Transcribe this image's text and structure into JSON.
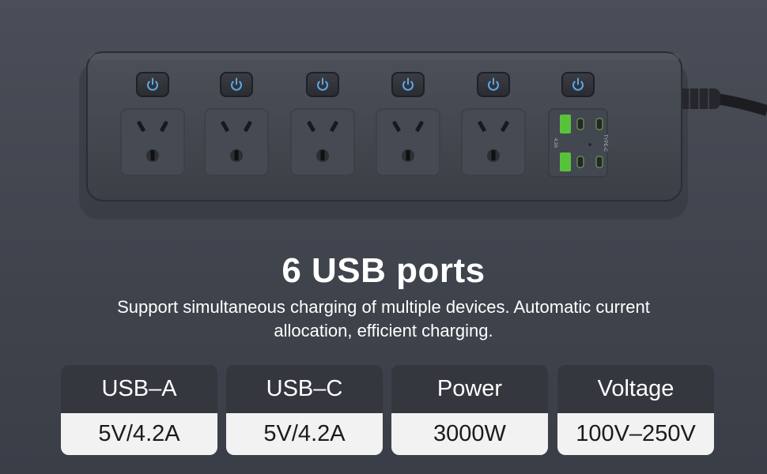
{
  "product": {
    "usb_a_rating": "4.2A",
    "type_c_label": "TYPE-C",
    "outlet_count": 5,
    "switch_count": 6,
    "switch_icon": "power-icon",
    "switch_light_color": "#5aa8e6",
    "usb_a_color": "#58c33a"
  },
  "headline": "6 USB ports",
  "subtitle": {
    "line1": "Support simultaneous charging of multiple devices. Automatic current",
    "line2": "allocation, efficient charging."
  },
  "specs": [
    {
      "label": "USB–A",
      "value": "5V/4.2A"
    },
    {
      "label": "USB–C",
      "value": "5V/4.2A"
    },
    {
      "label": "Power",
      "value": "3000W"
    },
    {
      "label": "Voltage",
      "value": "100V–250V"
    }
  ]
}
